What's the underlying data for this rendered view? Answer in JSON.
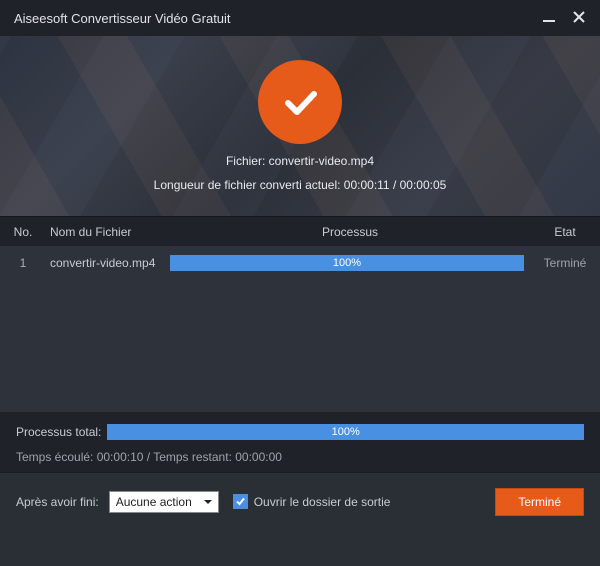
{
  "titlebar": {
    "title": "Aiseesoft Convertisseur Vidéo Gratuit"
  },
  "hero": {
    "file_label": "Fichier: convertir-video.mp4",
    "length_label": "Longueur de fichier converti actuel: 00:00:11 / 00:00:05"
  },
  "table": {
    "headers": {
      "no": "No.",
      "name": "Nom du Fichier",
      "process": "Processus",
      "state": "Etat"
    },
    "rows": [
      {
        "no": "1",
        "name": "convertir-video.mp4",
        "percent": "100%",
        "state": "Terminé"
      }
    ]
  },
  "total": {
    "label": "Processus total:",
    "percent": "100%",
    "time_text": "Temps écoulé: 00:00:10 / Temps restant: 00:00:00"
  },
  "footer": {
    "after_label": "Après avoir fini:",
    "select_value": "Aucune action",
    "open_folder_label": "Ouvrir le dossier de sortie",
    "done_button": "Terminé"
  },
  "colors": {
    "accent": "#e65a1a",
    "progress": "#4a90e2"
  }
}
